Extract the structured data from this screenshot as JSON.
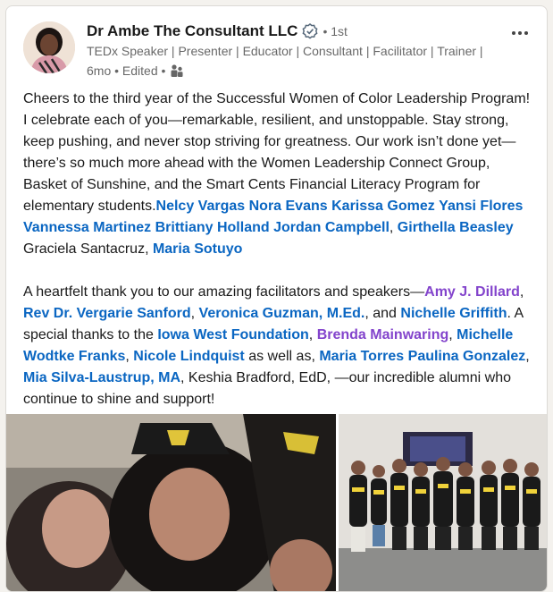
{
  "post": {
    "author": {
      "name": "Dr Ambe The Consultant LLC",
      "degree": "• 1st",
      "headline": "TEDx Speaker | Presenter | Educator | Consultant | Facilitator | Trainer |",
      "time": "6mo • Edited •"
    },
    "icons": {
      "verified": "verified-badge-icon",
      "audience": "people-icon",
      "more": "ellipsis-icon"
    },
    "paragraph1": {
      "text": "Cheers to the third year of the Successful Women of Color Leadership Program! I celebrate each of you—remarkable, resilient, and unstoppable. Stay strong, keep pushing, and never stop striving for greatness. Our work isn’t done yet—there’s so much more ahead with the Women Leadership Connect Group, Basket of Sunshine, and the Smart Cents Financial Literacy Program for elementary students.",
      "m1": "Nelcy Vargas",
      "m2": "Nora Evans",
      "m3": "Karissa Gomez",
      "m4": "Yansi Flores",
      "m5": "Vannessa Martinez",
      "m6": "Brittiany Holland",
      "m7": "Jordan Campbell",
      "comma1": ", ",
      "m8": "Girthella Beasley",
      "plain1": " Graciela Santacruz, ",
      "m9": "Maria Sotuyo"
    },
    "paragraph2": {
      "t1": "A heartfelt thank you to our amazing facilitators and speakers—",
      "m1": "Amy J. Dillard",
      "t2": ", ",
      "m2": "Rev Dr. Vergarie Sanford",
      "t3": ", ",
      "m3": "Veronica Guzman, M.Ed.",
      "t4": ", and ",
      "m4": "Nichelle Griffith",
      "t5": ". A special thanks to the ",
      "m5": "Iowa West Foundation",
      "t6": ", ",
      "m6": "Brenda Mainwaring",
      "t7": ", ",
      "m7": "Michelle Wodtke Franks",
      "t8": ", ",
      "m8": "Nicole Lindquist",
      "t9": " as well as, ",
      "m9": "Maria Torres Paulina Gonzalez",
      "t10": ", ",
      "m10": "Mia Silva-Laustrup, MA",
      "t11": ", Keshia Bradford, EdD, —our incredible alumni who continue to shine and support!"
    },
    "colors": {
      "mention_blue": "#0a66c2",
      "mention_purple": "#8344cc",
      "text": "#191919",
      "muted": "#666666"
    }
  }
}
